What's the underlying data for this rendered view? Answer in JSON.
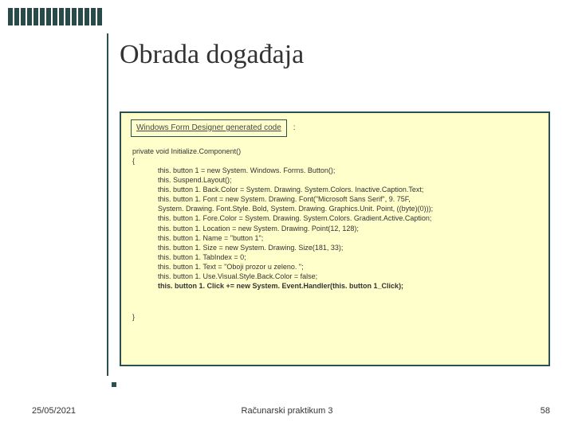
{
  "slide": {
    "title": "Obrada događaja",
    "wfd_label": "Windows Form Designer generated code",
    "colon": ":",
    "code": {
      "sig": "private void Initialize.Component()",
      "open": "{",
      "lines": [
        "this. button 1 = new System. Windows. Forms. Button();",
        "this. Suspend.Layout();",
        "this. button 1. Back.Color = System. Drawing. System.Colors. Inactive.Caption.Text;",
        "this. button 1. Font = new System. Drawing. Font(\"Microsoft Sans Serif\", 9. 75F,",
        "System. Drawing. Font.Style. Bold, System. Drawing. Graphics.Unit. Point, ((byte)(0)));",
        "this. button 1. Fore.Color = System. Drawing. System.Colors. Gradient.Active.Caption;",
        "this. button 1. Location = new System. Drawing. Point(12, 128);",
        "this. button 1. Name = \"button 1\";",
        "this. button 1. Size = new System. Drawing. Size(181, 33);",
        "this. button 1. TabIndex = 0;",
        "this. button 1. Text = \"Oboji prozor u zeleno. \";",
        "this. button 1. Use.Visual.Style.Back.Color = false;"
      ],
      "bold_line": "this. button 1. Click += new System. Event.Handler(this. button 1_Click);",
      "close": "}"
    }
  },
  "footer": {
    "date": "25/05/2021",
    "center": "Računarski praktikum 3",
    "page": "58"
  }
}
